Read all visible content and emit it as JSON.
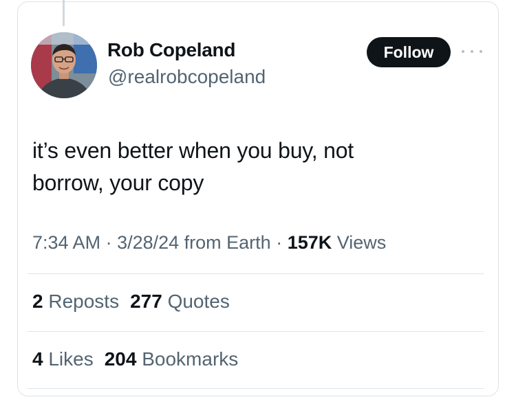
{
  "author": {
    "name": "Rob Copeland",
    "handle": "@realrobcopeland"
  },
  "follow_button": "Follow",
  "more_icon": "more-horizontal-icon",
  "tweet": {
    "line1": "it’s even better when you buy, not",
    "line2": "borrow, your copy"
  },
  "meta": {
    "time": "7:34 AM",
    "sep1": " · ",
    "date": "3/28/24",
    "source": " from Earth",
    "sep2": " · ",
    "views_count": "157K",
    "views_label": " Views"
  },
  "stats": {
    "reposts_count": "2",
    "reposts_label": "Reposts",
    "quotes_count": "277",
    "quotes_label": "Quotes",
    "likes_count": "4",
    "likes_label": "Likes",
    "bookmarks_count": "204",
    "bookmarks_label": "Bookmarks"
  },
  "colors": {
    "text": "#0f1419",
    "secondary": "#536471",
    "border": "#dfe3e6",
    "button_bg": "#0f1419",
    "button_text": "#ffffff"
  }
}
